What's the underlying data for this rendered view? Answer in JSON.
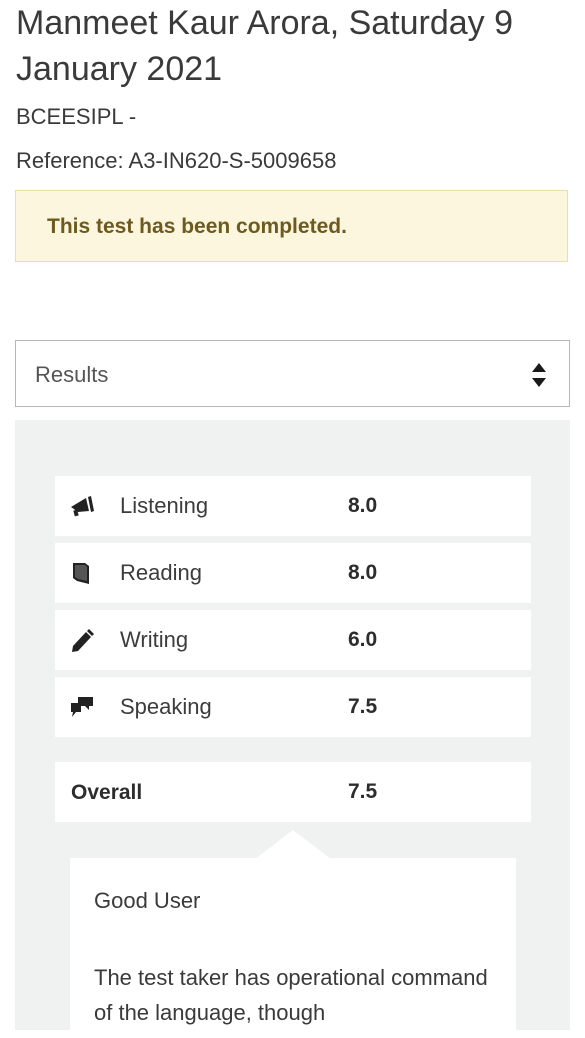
{
  "header": {
    "title": "Manmeet Kaur Arora, Saturday 9 January 2021",
    "organisation": "BCEESIPL -",
    "reference": "Reference: A3-IN620-S-5009658"
  },
  "alert": {
    "message": "This test has been completed."
  },
  "selector": {
    "value": "Results"
  },
  "results": {
    "rows": [
      {
        "skill": "Listening",
        "score": "8.0",
        "icon": "megaphone-icon"
      },
      {
        "skill": "Reading",
        "score": "8.0",
        "icon": "book-icon"
      },
      {
        "skill": "Writing",
        "score": "6.0",
        "icon": "pencil-icon"
      },
      {
        "skill": "Speaking",
        "score": "7.5",
        "icon": "speech-bubbles-icon"
      }
    ],
    "overall": {
      "label": "Overall",
      "score": "7.5"
    }
  },
  "band_description": {
    "band": "Good User",
    "text": "The test taker has operational command of the language, though"
  }
}
